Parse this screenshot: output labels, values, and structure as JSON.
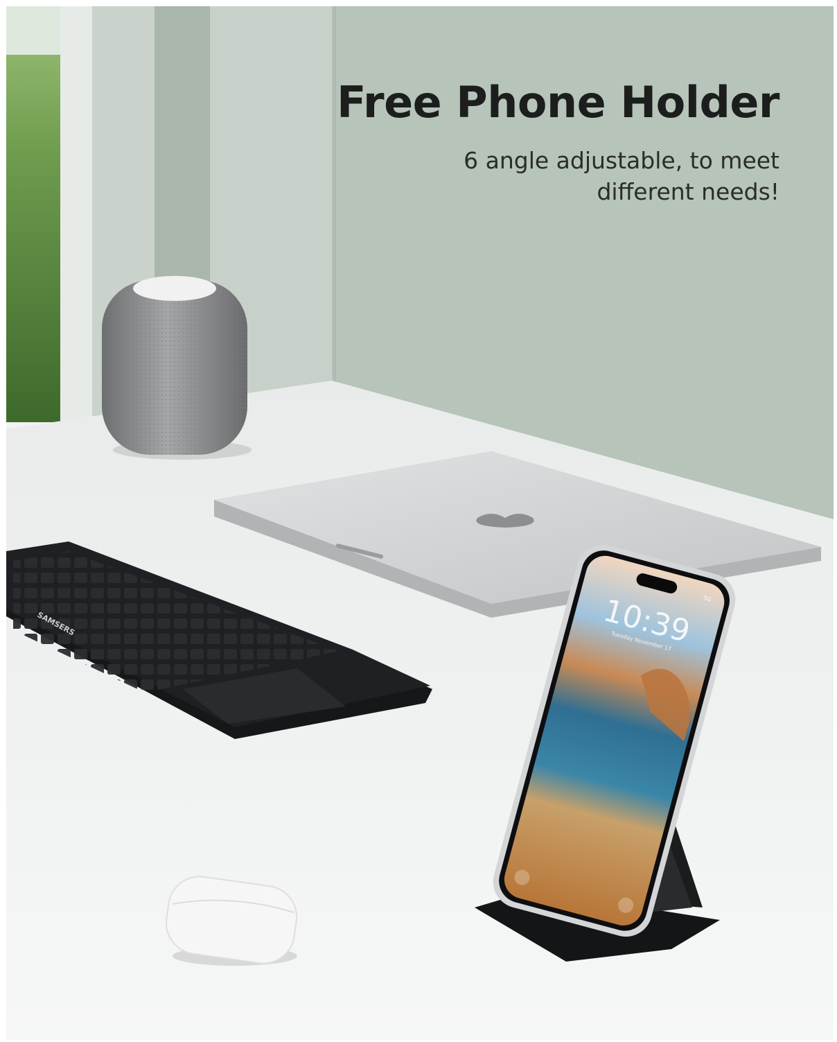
{
  "headline": {
    "title": "Free Phone Holder",
    "subtitle_line1": "6 angle adjustable, to meet",
    "subtitle_line2": "different needs!"
  },
  "keyboard": {
    "brand": "SAMSERS"
  },
  "phone": {
    "time": "10:39",
    "date": "Tuesday November 17",
    "status": "5G"
  },
  "colors": {
    "wall": "#b8c5bc",
    "desk": "#eef0f0",
    "keyboard": "#1e1f22",
    "phone_frame": "#d8d8da",
    "stand": "#1b1c1e"
  }
}
